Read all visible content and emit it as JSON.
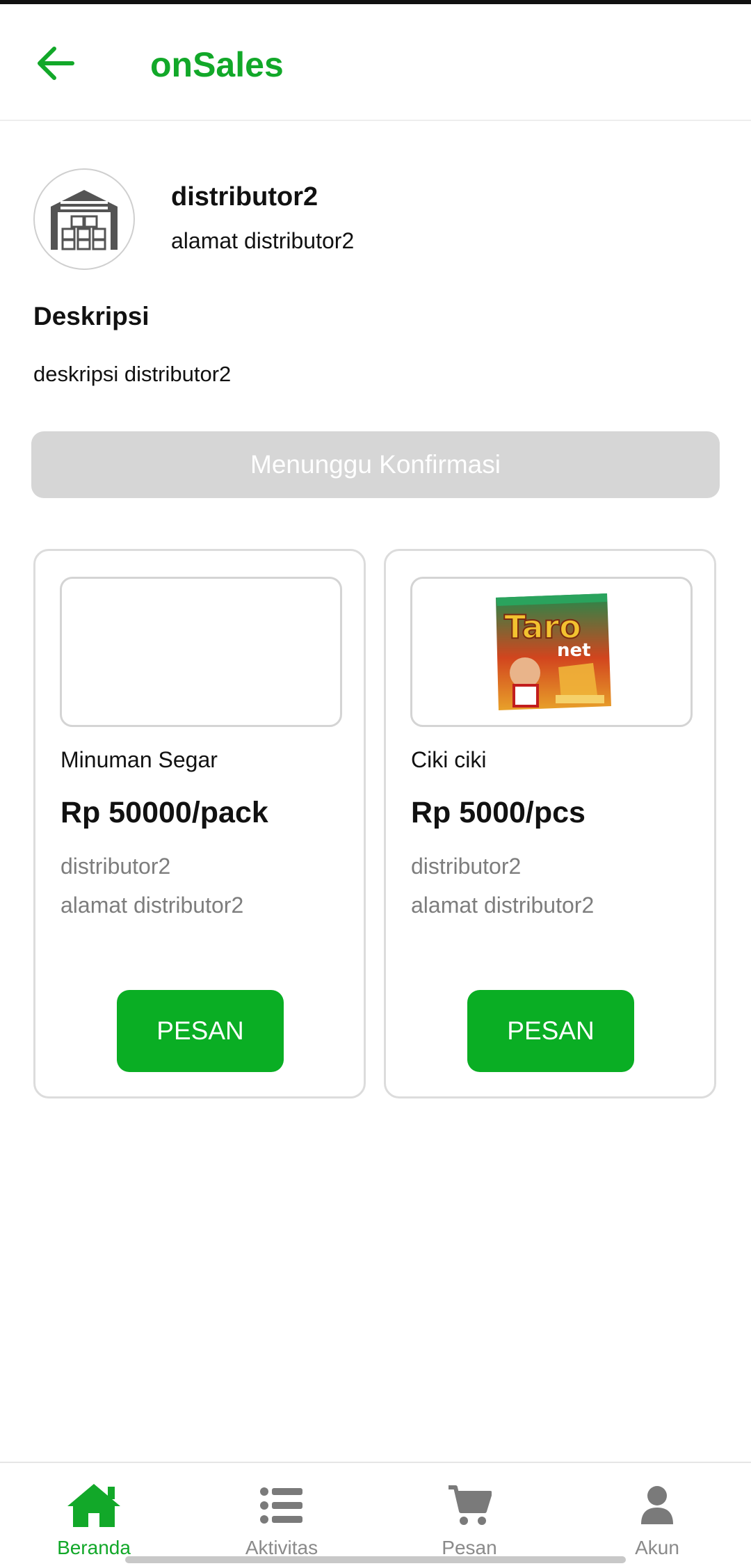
{
  "app": {
    "title": "onSales"
  },
  "colors": {
    "brand": "#12a829",
    "button": "#0aae24",
    "disabled": "#d6d6d6",
    "muted": "#7d7d7d"
  },
  "distributor": {
    "name": "distributor2",
    "address": "alamat distributor2",
    "avatar_icon": "warehouse-icon"
  },
  "description": {
    "heading": "Deskripsi",
    "text": "deskripsi distributor2"
  },
  "status_button": {
    "label": "Menunggu Konfirmasi",
    "state": "disabled"
  },
  "products": [
    {
      "name": "Minuman Segar",
      "price": "Rp 50000/pack",
      "distributor": "distributor2",
      "address": "alamat distributor2",
      "image": "empty",
      "button": "PESAN"
    },
    {
      "name": "Ciki ciki",
      "price": "Rp 5000/pcs",
      "distributor": "distributor2",
      "address": "alamat distributor2",
      "image": "snack-package",
      "image_text_1": "Taro",
      "image_text_2": "net",
      "button": "PESAN"
    }
  ],
  "bottom_nav": {
    "items": [
      {
        "label": "Beranda",
        "icon": "home-icon",
        "active": true
      },
      {
        "label": "Aktivitas",
        "icon": "list-icon",
        "active": false
      },
      {
        "label": "Pesan",
        "icon": "cart-icon",
        "active": false
      },
      {
        "label": "Akun",
        "icon": "user-icon",
        "active": false
      }
    ]
  }
}
